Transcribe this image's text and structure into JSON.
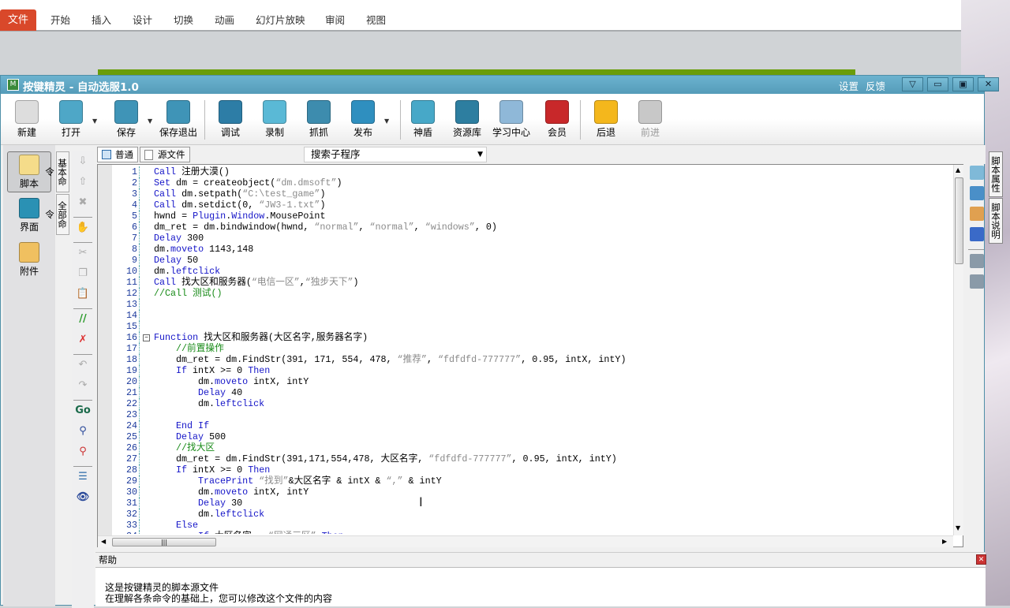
{
  "ppt": {
    "file_tab": "文件",
    "tabs": [
      "开始",
      "插入",
      "设计",
      "切换",
      "动画",
      "幻灯片放映",
      "审阅",
      "视图"
    ]
  },
  "window": {
    "title": "按键精灵 - 自动选服1.0",
    "links": [
      "设置",
      "反馈"
    ],
    "buttons": [
      "▽",
      "▭",
      "▣",
      "✕"
    ]
  },
  "toolbar": [
    {
      "label": "新建",
      "icon": "new-file-icon",
      "color": "#ddd"
    },
    {
      "label": "打开",
      "icon": "open-folder-icon",
      "color": "#4ea7c7",
      "dropdown": true
    },
    {
      "label": "保存",
      "icon": "save-icon",
      "color": "#3f94b7",
      "dropdown": true
    },
    {
      "label": "保存退出",
      "icon": "save-exit-icon",
      "color": "#3f94b7"
    },
    {
      "label": "调试",
      "icon": "debug-icon",
      "color": "#2d7da6"
    },
    {
      "label": "录制",
      "icon": "record-icon",
      "color": "#5ab9d6"
    },
    {
      "label": "抓抓",
      "icon": "grab-icon",
      "color": "#3d8cae"
    },
    {
      "label": "发布",
      "icon": "publish-globe-icon",
      "color": "#2f8fbf",
      "dropdown": true
    },
    {
      "label": "神盾",
      "icon": "shield-icon",
      "color": "#47a8c8"
    },
    {
      "label": "资源库",
      "icon": "resource-library-icon",
      "color": "#2d7ea0"
    },
    {
      "label": "学习中心",
      "icon": "learning-center-icon",
      "color": "#8fb8d8"
    },
    {
      "label": "会员",
      "icon": "member-icon",
      "color": "#c8282a"
    },
    {
      "label": "后退",
      "icon": "back-arrow-icon",
      "color": "#f4b71c"
    },
    {
      "label": "前进",
      "icon": "forward-arrow-icon",
      "color": "#c8c8c8",
      "disabled": true
    }
  ],
  "leftnav": [
    {
      "label": "脚本",
      "icon": "script-icon",
      "color": "#f5dc8a",
      "selected": true
    },
    {
      "label": "界面",
      "icon": "interface-icon",
      "color": "#2a91b4"
    },
    {
      "label": "附件",
      "icon": "attachment-icon",
      "color": "#f0c060"
    }
  ],
  "command_tabs": [
    "基本命令",
    "全部命令"
  ],
  "editor_tabs": [
    {
      "label": "普通",
      "icon": "normal-view-icon"
    },
    {
      "label": "源文件",
      "icon": "source-file-icon"
    }
  ],
  "sub_program_search": "搜索子程序",
  "tools": [
    {
      "icon": "move-down-icon",
      "glyph": "⇩"
    },
    {
      "icon": "move-up-icon",
      "glyph": "⇧"
    },
    {
      "icon": "delete-icon",
      "glyph": "✖"
    },
    "sep",
    {
      "icon": "hand-icon",
      "glyph": "✋",
      "color": "#d98a2a"
    },
    "sep",
    {
      "icon": "cut-icon",
      "glyph": "✂"
    },
    {
      "icon": "copy-icon",
      "glyph": "❐"
    },
    {
      "icon": "paste-icon",
      "glyph": "📋"
    },
    "sep",
    {
      "icon": "comment-icon",
      "glyph": "//",
      "color": "#2a9a2a"
    },
    {
      "icon": "uncomment-icon",
      "glyph": "✗",
      "color": "#d33"
    },
    "sep",
    {
      "icon": "undo-icon",
      "glyph": "↶"
    },
    {
      "icon": "redo-icon",
      "glyph": "↷"
    },
    "sep",
    {
      "icon": "goto-icon",
      "glyph": "Go",
      "color": "#1a6a4a"
    },
    {
      "icon": "find-icon",
      "glyph": "⚲",
      "color": "#2b4a9a"
    },
    {
      "icon": "replace-icon",
      "glyph": "⚲",
      "color": "#c33"
    },
    "sep",
    {
      "icon": "outline-icon",
      "glyph": "☰",
      "color": "#2b6aa8"
    },
    {
      "icon": "watch-icon",
      "glyph": "👁",
      "color": "#2b4a9a"
    }
  ],
  "code": [
    {
      "n": "1",
      "i": 0,
      "p": [
        [
          "k",
          "Call"
        ],
        [
          "t",
          " 注册大漠()"
        ]
      ]
    },
    {
      "n": "2",
      "i": 0,
      "p": [
        [
          "k",
          "Set"
        ],
        [
          "t",
          " dm = createobject("
        ],
        [
          "s",
          "“dm.dmsoft”"
        ],
        [
          "t",
          ")"
        ]
      ]
    },
    {
      "n": "3",
      "i": 0,
      "p": [
        [
          "k",
          "Call"
        ],
        [
          "t",
          " dm.setpath("
        ],
        [
          "s",
          "“C:\\test_game”"
        ],
        [
          "t",
          ")"
        ]
      ]
    },
    {
      "n": "4",
      "i": 0,
      "p": [
        [
          "k",
          "Call"
        ],
        [
          "t",
          " dm.setdict(0, "
        ],
        [
          "s",
          "“JW3-1.txt”"
        ],
        [
          "t",
          ")"
        ]
      ]
    },
    {
      "n": "5",
      "i": 0,
      "p": [
        [
          "t",
          "hwnd = "
        ],
        [
          "k",
          "Plugin"
        ],
        [
          "t",
          "."
        ],
        [
          "k",
          "Window"
        ],
        [
          "t",
          ".MousePoint"
        ]
      ]
    },
    {
      "n": "6",
      "i": 0,
      "p": [
        [
          "t",
          "dm_ret = dm.bindwindow(hwnd, "
        ],
        [
          "s",
          "“normal”"
        ],
        [
          "t",
          ", "
        ],
        [
          "s",
          "“normal”"
        ],
        [
          "t",
          ", "
        ],
        [
          "s",
          "“windows”"
        ],
        [
          "t",
          ", 0)"
        ]
      ]
    },
    {
      "n": "7",
      "i": 0,
      "p": [
        [
          "k",
          "Delay"
        ],
        [
          "t",
          " 300"
        ]
      ]
    },
    {
      "n": "8",
      "i": 0,
      "p": [
        [
          "t",
          "dm."
        ],
        [
          "k",
          "moveto"
        ],
        [
          "t",
          " 1143,148"
        ]
      ]
    },
    {
      "n": "9",
      "i": 0,
      "p": [
        [
          "k",
          "Delay"
        ],
        [
          "t",
          " 50"
        ]
      ]
    },
    {
      "n": "10",
      "i": 0,
      "p": [
        [
          "t",
          "dm."
        ],
        [
          "k",
          "leftclick"
        ]
      ]
    },
    {
      "n": "11",
      "i": 0,
      "p": [
        [
          "k",
          "Call"
        ],
        [
          "t",
          " 找大区和服务器("
        ],
        [
          "s",
          "“电信一区”"
        ],
        [
          "t",
          ","
        ],
        [
          "s",
          "“独步天下”"
        ],
        [
          "t",
          ")"
        ]
      ]
    },
    {
      "n": "12",
      "i": 0,
      "p": [
        [
          "c",
          "//Call 测试()"
        ]
      ]
    },
    {
      "n": "13",
      "i": 0,
      "p": []
    },
    {
      "n": "14",
      "i": 0,
      "p": []
    },
    {
      "n": "15",
      "i": 0,
      "p": []
    },
    {
      "n": "16",
      "i": 0,
      "fold": true,
      "p": [
        [
          "k",
          "Function"
        ],
        [
          "t",
          " 找大区和服务器(大区名字,服务器名字)"
        ]
      ]
    },
    {
      "n": "17",
      "i": 1,
      "p": [
        [
          "c",
          "//前置操作"
        ]
      ]
    },
    {
      "n": "18",
      "i": 1,
      "p": [
        [
          "t",
          "dm_ret = dm.FindStr(391, 171, 554, 478, "
        ],
        [
          "s",
          "“推荐”"
        ],
        [
          "t",
          ", "
        ],
        [
          "s",
          "“fdfdfd-777777”"
        ],
        [
          "t",
          ", 0.95, intX, intY)"
        ]
      ]
    },
    {
      "n": "19",
      "i": 1,
      "p": [
        [
          "k",
          "If"
        ],
        [
          "t",
          " intX >= 0 "
        ],
        [
          "k",
          "Then"
        ]
      ]
    },
    {
      "n": "20",
      "i": 2,
      "p": [
        [
          "t",
          "dm."
        ],
        [
          "k",
          "moveto"
        ],
        [
          "t",
          " intX, intY"
        ]
      ]
    },
    {
      "n": "21",
      "i": 2,
      "p": [
        [
          "k",
          "Delay"
        ],
        [
          "t",
          " 40"
        ]
      ]
    },
    {
      "n": "22",
      "i": 2,
      "p": [
        [
          "t",
          "dm."
        ],
        [
          "k",
          "leftclick"
        ]
      ]
    },
    {
      "n": "23",
      "i": 0,
      "p": []
    },
    {
      "n": "24",
      "i": 1,
      "p": [
        [
          "k",
          "End If"
        ]
      ]
    },
    {
      "n": "25",
      "i": 1,
      "p": [
        [
          "k",
          "Delay"
        ],
        [
          "t",
          " 500"
        ]
      ]
    },
    {
      "n": "26",
      "i": 1,
      "p": [
        [
          "c",
          "//找大区"
        ]
      ]
    },
    {
      "n": "27",
      "i": 1,
      "p": [
        [
          "t",
          "dm_ret = dm.FindStr(391,171,554,478, 大区名字, "
        ],
        [
          "s",
          "“fdfdfd-777777”"
        ],
        [
          "t",
          ", 0.95, intX, intY)"
        ]
      ]
    },
    {
      "n": "28",
      "i": 1,
      "p": [
        [
          "k",
          "If"
        ],
        [
          "t",
          " intX >= 0 "
        ],
        [
          "k",
          "Then"
        ]
      ]
    },
    {
      "n": "29",
      "i": 2,
      "p": [
        [
          "k",
          "TracePrint"
        ],
        [
          "t",
          " "
        ],
        [
          "s",
          "“找到”"
        ],
        [
          "t",
          "&大区名字 & intX & "
        ],
        [
          "s",
          "“,”"
        ],
        [
          "t",
          " & intY"
        ]
      ]
    },
    {
      "n": "30",
      "i": 2,
      "p": [
        [
          "t",
          "dm."
        ],
        [
          "k",
          "moveto"
        ],
        [
          "t",
          " intX, intY"
        ]
      ]
    },
    {
      "n": "31",
      "i": 2,
      "p": [
        [
          "k",
          "Delay"
        ],
        [
          "t",
          " 30"
        ]
      ]
    },
    {
      "n": "32",
      "i": 2,
      "p": [
        [
          "t",
          "dm."
        ],
        [
          "k",
          "leftclick"
        ]
      ]
    },
    {
      "n": "33",
      "i": 1,
      "p": [
        [
          "k",
          "Else"
        ]
      ]
    },
    {
      "n": "34",
      "i": 2,
      "p": [
        [
          "k",
          "If"
        ],
        [
          "t",
          " 大区名字 = "
        ],
        [
          "s",
          "“网通三区”"
        ],
        [
          "t",
          " "
        ],
        [
          "k",
          "Then"
        ]
      ]
    }
  ],
  "right_tools": [
    {
      "icon": "notepad-icon",
      "color": "#7fb9d8"
    },
    {
      "icon": "calculator-icon",
      "color": "#4a8fc8"
    },
    {
      "icon": "palette-icon",
      "color": "#e0a050"
    },
    {
      "icon": "plugin-icon",
      "color": "#3a6ac8"
    },
    "sep",
    {
      "icon": "add-tool-icon",
      "color": "#8a9aa8"
    },
    {
      "icon": "remove-tool-icon",
      "color": "#8a9aa8"
    }
  ],
  "right_tabs": [
    "脚本属性",
    "脚本说明"
  ],
  "help": {
    "title": "帮助",
    "lines": [
      "这是按键精灵的脚本源文件",
      "在理解各条命令的基础上，您可以修改这个文件的内容"
    ]
  }
}
